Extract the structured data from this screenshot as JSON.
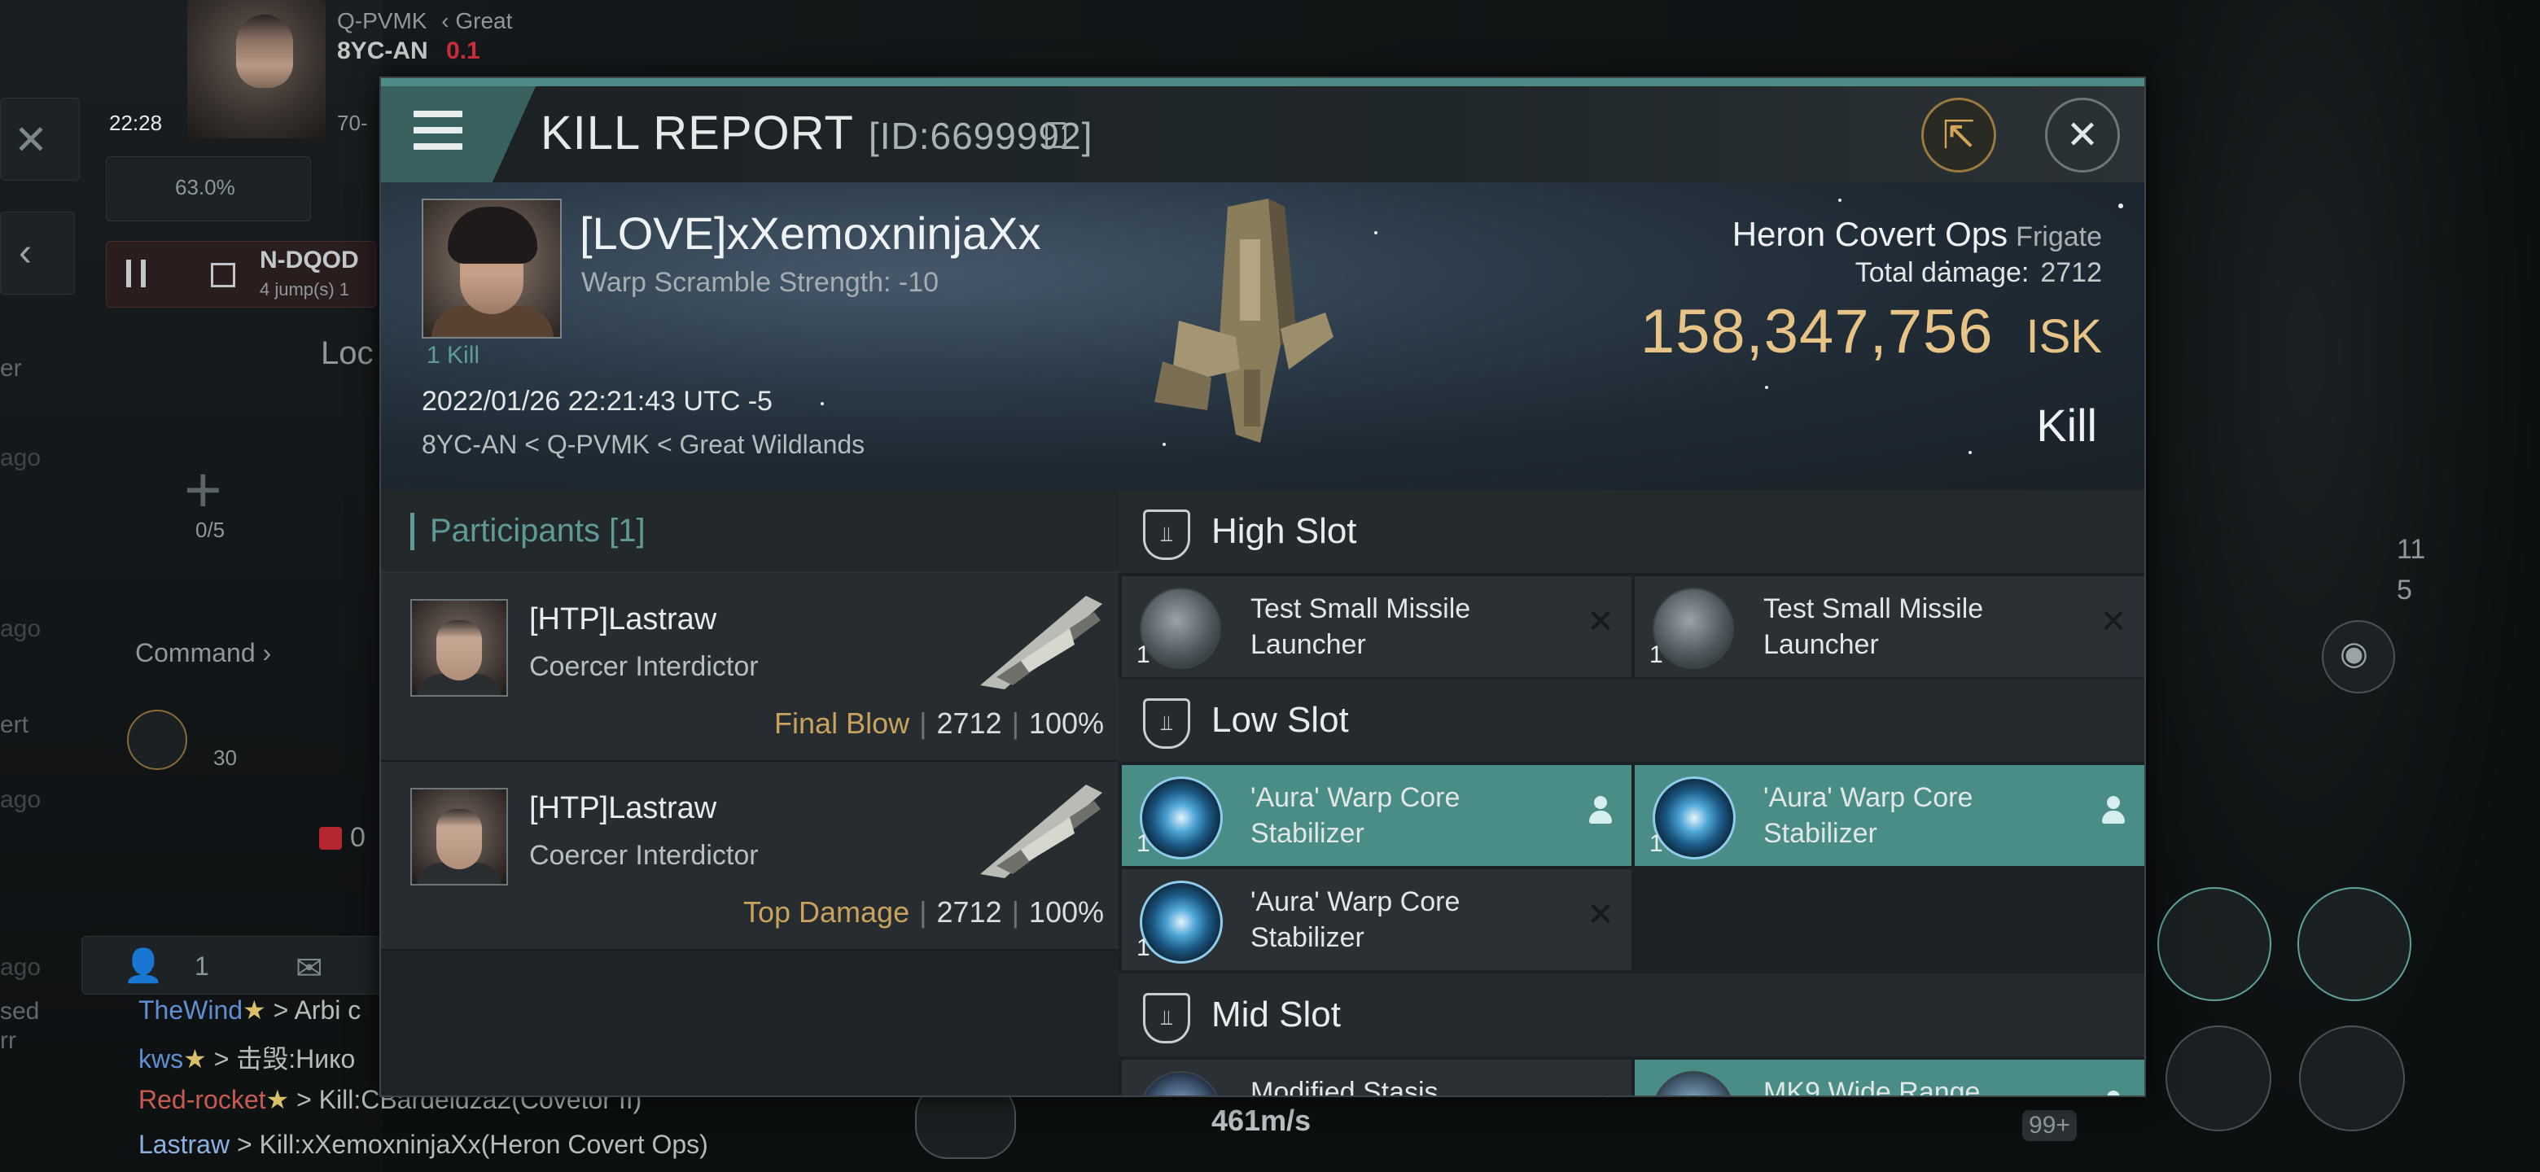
{
  "background": {
    "pilot_corner": {
      "system_parent": "Q-PVMK",
      "region": "Great",
      "system": "8YC-AN",
      "security": "0.1",
      "time": "22:28",
      "level": "70-"
    },
    "resource_pct": "63.0%",
    "route": {
      "destination": "N-DQOD",
      "jumps": "4 jump(s) 1"
    },
    "loc_label": "Loc",
    "slots": "0/5",
    "command_label": "Command",
    "dial_value": "30",
    "red_count": "0",
    "left_snips": [
      "er",
      "ago",
      "ago",
      "ert",
      "ago",
      "ago",
      "sed",
      "rr"
    ],
    "bottom_bar": {
      "count": "1"
    },
    "chat": [
      {
        "name": "TheWind",
        "text": " > Arbi c"
      },
      {
        "name": "kws",
        "text": " > 击毁:Нико"
      },
      {
        "name": "Red-rocket",
        "text": " > Kill:CBardeldza2(Covetor II)"
      },
      {
        "name": "Lastraw",
        "text": " > Kill:xXemoxninjaXx(Heron Covert Ops)"
      }
    ],
    "speed": "461m/s",
    "right_counts": {
      "a": "11",
      "b": "5"
    },
    "overload_badge": "99+"
  },
  "panel": {
    "title": "KILL REPORT",
    "id_text": "[ID:6699992]",
    "colors": {
      "accent": "#4e8a86",
      "isk": "#e7c386",
      "dropped": "#4a8c86"
    }
  },
  "victim": {
    "name": "[LOVE]xXemoxninjaXx",
    "warp_scramble": "Warp Scramble Strength: -10",
    "kill_count": "1 Kill",
    "datetime": "2022/01/26 22:21:43 UTC -5",
    "location": "8YC-AN < Q-PVMK < Great Wildlands",
    "ship_name": "Heron Covert Ops",
    "ship_class": "Frigate",
    "total_damage_label": "Total damage:",
    "total_damage": "2712",
    "isk_value": "158,347,756",
    "isk_unit": "ISK",
    "result": "Kill"
  },
  "participants": {
    "title": "Participants",
    "count": "[1]",
    "rows": [
      {
        "name": "[HTP]Lastraw",
        "ship": "Coercer Interdictor",
        "role": "Final Blow",
        "damage": "2712",
        "percent": "100%"
      },
      {
        "name": "[HTP]Lastraw",
        "ship": "Coercer Interdictor",
        "role": "Top Damage",
        "damage": "2712",
        "percent": "100%"
      }
    ]
  },
  "fitting": {
    "high": {
      "title": "High Slot",
      "modules": [
        {
          "qty": "1",
          "name": "Test Small Missile Launcher",
          "icon": "missile-launcher-icon",
          "state": "destroyed"
        },
        {
          "qty": "1",
          "name": "Test Small Missile Launcher",
          "icon": "missile-launcher-icon",
          "state": "destroyed"
        }
      ]
    },
    "low": {
      "title": "Low Slot",
      "modules": [
        {
          "qty": "1",
          "name": "'Aura' Warp Core Stabilizer",
          "icon": "warp-core-stabilizer-icon",
          "state": "dropped"
        },
        {
          "qty": "1",
          "name": "'Aura' Warp Core Stabilizer",
          "icon": "warp-core-stabilizer-icon",
          "state": "dropped"
        },
        {
          "qty": "1",
          "name": "'Aura' Warp Core Stabilizer",
          "icon": "warp-core-stabilizer-icon",
          "state": "destroyed"
        }
      ]
    },
    "mid": {
      "title": "Mid Slot",
      "modules": [
        {
          "qty": "",
          "name": "Modified Stasis",
          "icon": "stasis-webifier-icon",
          "state": "destroyed"
        },
        {
          "qty": "",
          "name": "MK9 Wide Range",
          "icon": "shield-extender-icon",
          "state": "dropped"
        }
      ]
    }
  }
}
